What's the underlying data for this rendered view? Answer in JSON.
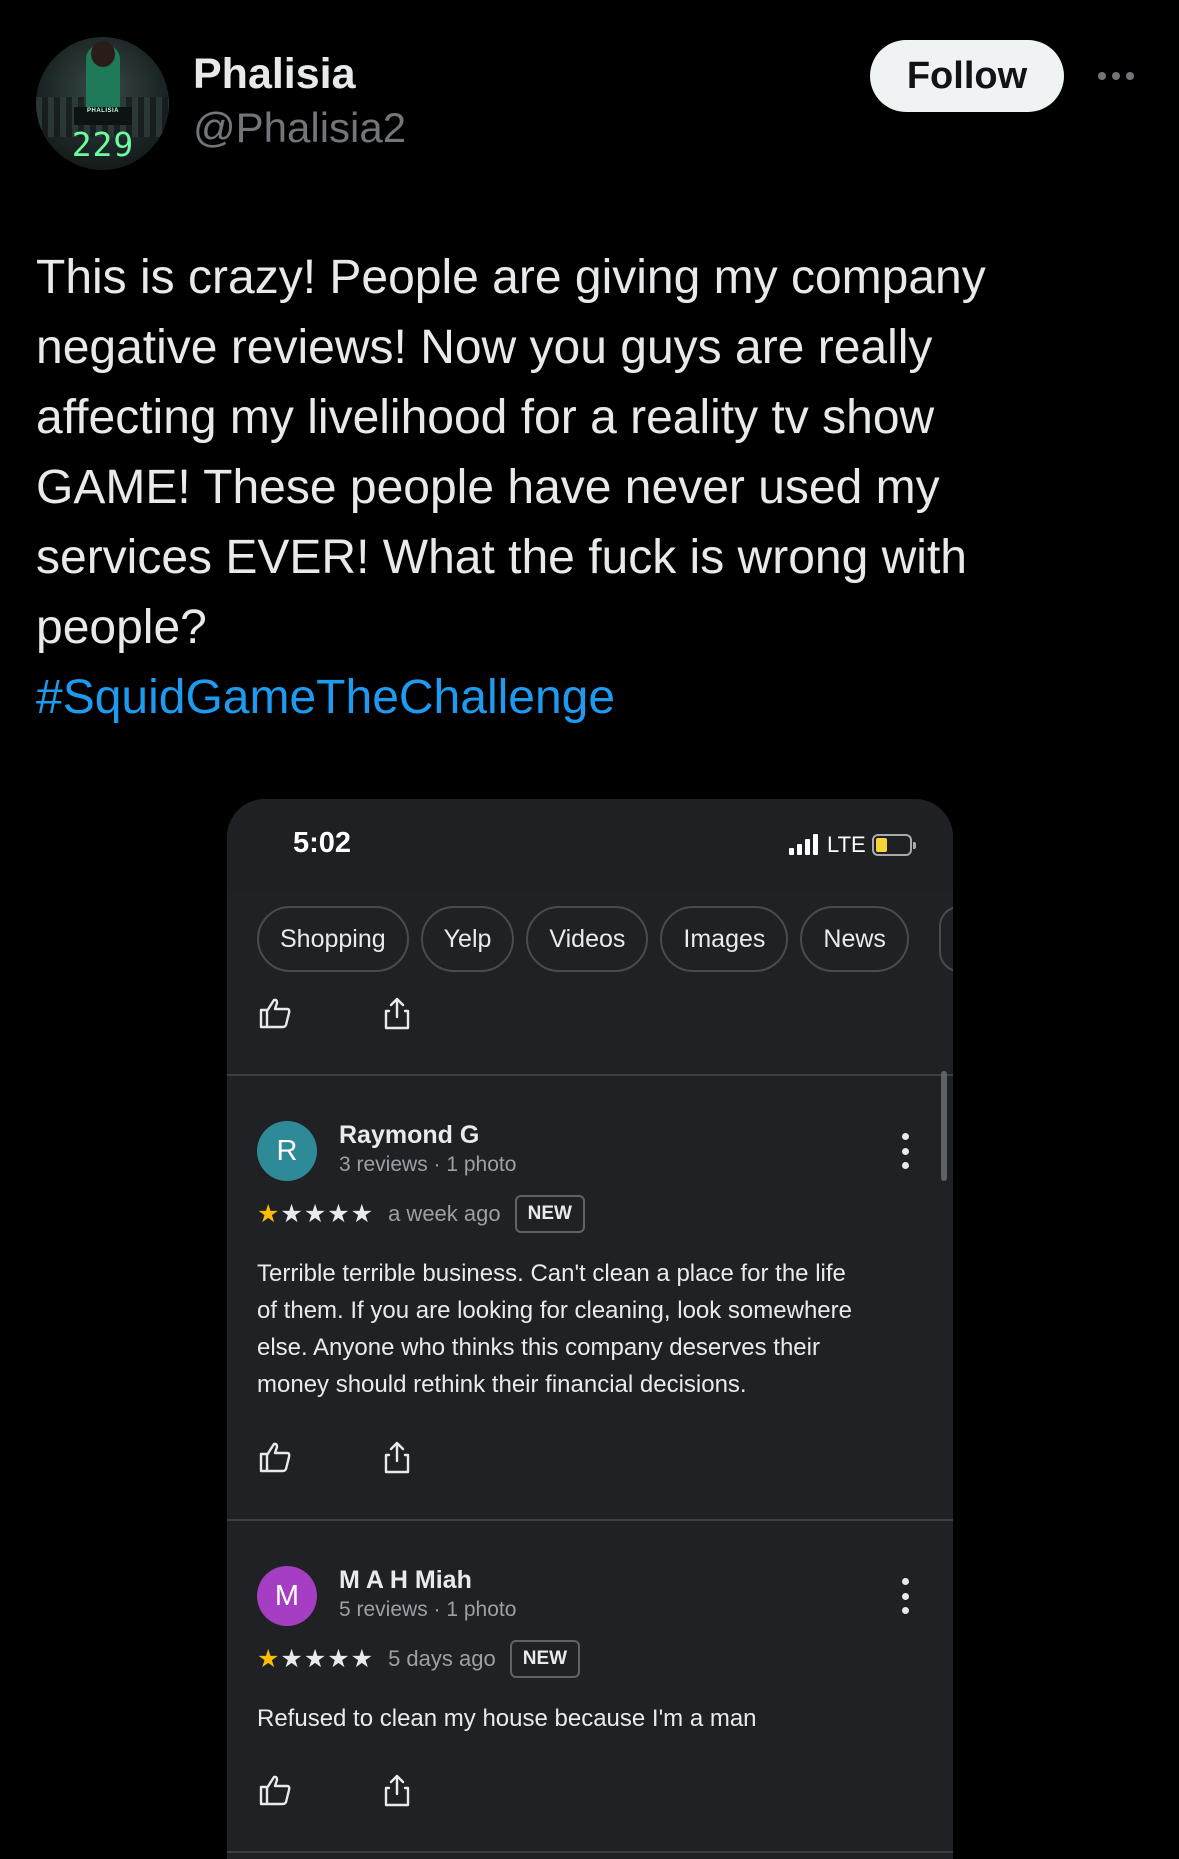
{
  "header": {
    "display_name": "Phalisia",
    "handle": "@Phalisia2",
    "follow_label": "Follow",
    "avatar": {
      "plate_text": "PHALISIA",
      "number": "229"
    }
  },
  "tweet": {
    "lines": [
      "This is crazy! People are giving my company",
      "negative reviews! Now you guys are really",
      "affecting my livelihood for a reality tv show",
      "GAME! These people have never used my",
      "services EVER! What the fuck is wrong with",
      "people?"
    ],
    "hashtag": "#SquidGameTheChallenge"
  },
  "phone": {
    "time": "5:02",
    "network": "LTE",
    "chips": [
      "Shopping",
      "Yelp",
      "Videos",
      "Images",
      "News"
    ],
    "reviews": [
      {
        "initial": "R",
        "avatar_color": "#2e8a96",
        "name": "Raymond G",
        "meta": "3 reviews · 1 photo",
        "rating": 1,
        "when": "a week ago",
        "badge": "NEW",
        "body_lines": [
          "Terrible terrible business. Can't clean a place for the life",
          "of them. If you are looking for cleaning, look somewhere",
          "else. Anyone who thinks this company deserves their",
          "money should rethink their financial decisions."
        ]
      },
      {
        "initial": "M",
        "avatar_color": "#a53ec2",
        "name": "M A H Miah",
        "meta": "5 reviews · 1 photo",
        "rating": 1,
        "when": "5 days ago",
        "badge": "NEW",
        "body_lines": [
          "Refused to clean my house because I'm a man"
        ]
      }
    ]
  },
  "colors": {
    "accent": "#1d9bf0",
    "star": "#fbbc04"
  }
}
